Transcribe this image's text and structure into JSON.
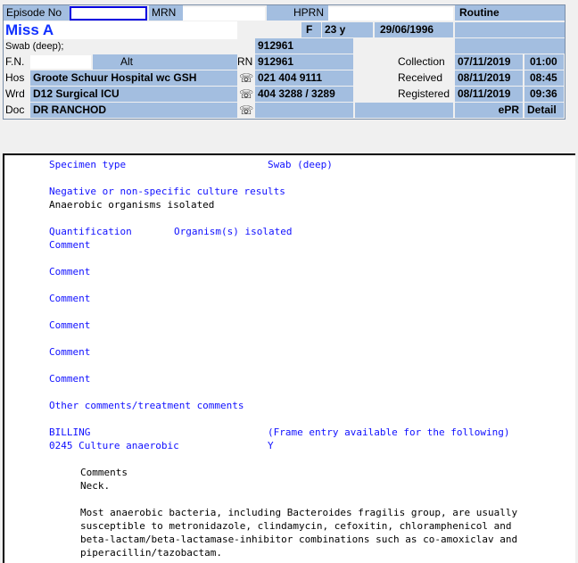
{
  "header": {
    "episode_label": "Episode No",
    "episode_value": "",
    "mrn_label": "MRN",
    "mrn_value": "",
    "hprn_label": "HPRN",
    "priority": "Routine",
    "patient_name": "Miss A",
    "sex": "F",
    "age": "23 y",
    "dob": "29/06/1996",
    "specimen_short": "Swab (deep);",
    "lab_number": "912961",
    "fn_label": "F.N.",
    "fn_value": "",
    "alt_label": "Alt",
    "rn_label": "RN",
    "rn_value": "912961",
    "collection_label": "Collection",
    "collection_date": "07/11/2019",
    "collection_time": "01:00",
    "hos_label": "Hos",
    "hospital": "Groote Schuur Hospital wc GSH",
    "hospital_phone": "021 404 9111",
    "received_label": "Received",
    "received_date": "08/11/2019",
    "received_time": "08:45",
    "wrd_label": "Wrd",
    "ward": "D12 Surgical ICU",
    "ward_phone": "404 3288 / 3289",
    "registered_label": "Registered",
    "registered_date": "08/11/2019",
    "registered_time": "09:36",
    "doc_label": "Doc",
    "doctor": "DR RANCHOD",
    "epr_label": "ePR",
    "detail_label": "Detail",
    "phone_glyph": "☏"
  },
  "report": {
    "specimen_type_label": "Specimen type",
    "specimen_type_value": "Swab (deep)",
    "negative_heading": "Negative or non-specific culture results",
    "negative_result": "Anaerobic organisms isolated",
    "quantification_label": "Quantification",
    "organisms_label": "Organism(s) isolated",
    "comment_labels": [
      "Comment",
      "Comment",
      "Comment",
      "Comment",
      "Comment",
      "Comment"
    ],
    "other_comments_label": "Other comments/treatment comments",
    "billing_label": "BILLING",
    "frame_entry_note": "(Frame entry available for the following)",
    "billing_code_label": "0245 Culture anaerobic",
    "billing_code_flag": "Y",
    "comments_heading": "Comments",
    "comments_neck": "Neck.",
    "susceptibility_lines": [
      "Most anaerobic bacteria, including Bacteroides fragilis group, are usually",
      "susceptible to metronidazole, clindamycin, cefoxitin, chloramphenicol and",
      "beta-lactam/beta-lactamase-inhibitor combinations such as co-amoxiclav and",
      "piperacillin/tazobactam."
    ]
  }
}
